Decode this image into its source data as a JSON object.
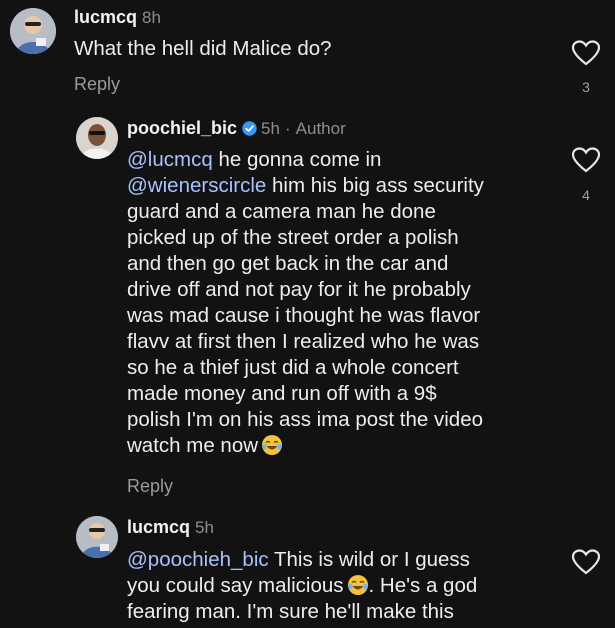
{
  "comments": [
    {
      "username": "lucmcq",
      "time": "8h",
      "text": "What the hell did Malice do?",
      "reply_label": "Reply",
      "likes": "3"
    },
    {
      "username": "poochiel_bic",
      "time": "5h",
      "separator": "·",
      "author_badge": "Author",
      "verified": true,
      "mention_1": "@lucmcq",
      "mention_2": "@wienerscircle",
      "lines": [
        " he gonna come in",
        " him his big ass security",
        "guard and a camera man he done",
        "picked up of the street order a polish",
        "and then go get back in the car and",
        "drive off and not pay for it he probably",
        "was mad cause i thought he was flavor",
        "flavv at first then I realized who he was",
        "so he a thief just did a whole concert",
        "made money and run off with a 9$",
        "polish I'm on his ass ima post the video",
        "watch me now"
      ],
      "reply_label": "Reply",
      "likes": "4"
    },
    {
      "username": "lucmcq",
      "time": "5h",
      "mention": "@poochieh_bic",
      "lines": [
        " This is wild or I guess",
        "you could say malicious",
        ". He's a god",
        "fearing man. I'm sure he'll make this"
      ]
    }
  ],
  "icons": {
    "heart": "heart-outline-icon",
    "verified": "verified-badge-icon",
    "emoji": "face-with-tears-of-joy-emoji"
  },
  "colors": {
    "background": "#121212",
    "mention": "#a6c2ff",
    "verified": "#3897f0",
    "secondary_text": "#8e8e8e"
  }
}
